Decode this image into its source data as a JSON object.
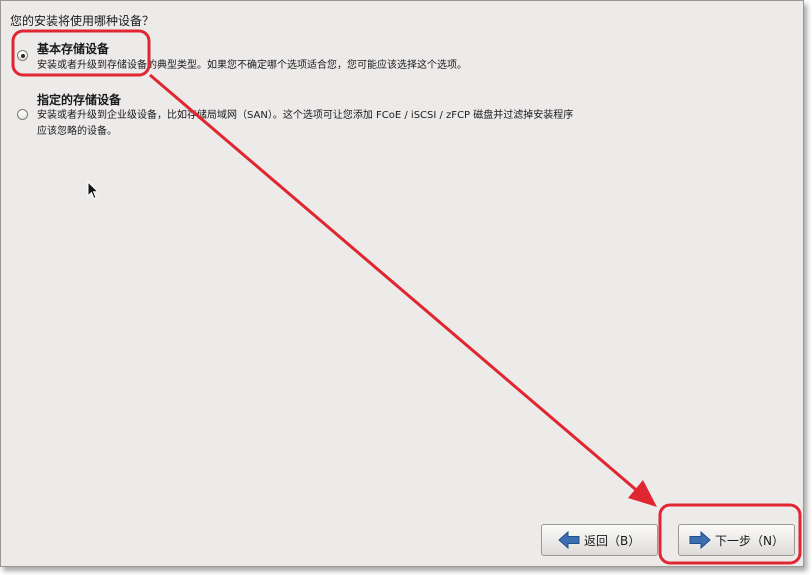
{
  "question": "您的安装将使用哪种设备？",
  "options": [
    {
      "title": "基本存储设备",
      "description": "安装或者升级到存储设备的典型类型。如果您不确定哪个选项适合您，您可能应该选择这个选项。",
      "selected": true
    },
    {
      "title": "指定的存储设备",
      "description": "安装或者升级到企业级设备，比如存储局域网（SAN）。这个选项可让您添加 FCoE / iSCSI / zFCP 磁盘并过滤掉安装程序\n应该忽略的设备。",
      "selected": false
    }
  ],
  "buttons": {
    "back_label": "返回（B）",
    "next_label": "下一步（N）"
  },
  "icons": {
    "back": "left-arrow-icon",
    "next": "right-arrow-icon",
    "cursor": "mouse-pointer-icon"
  },
  "colors": {
    "annotation": "#e02630",
    "background": "#edebea",
    "arrow_icon": "#3d6eb0"
  }
}
